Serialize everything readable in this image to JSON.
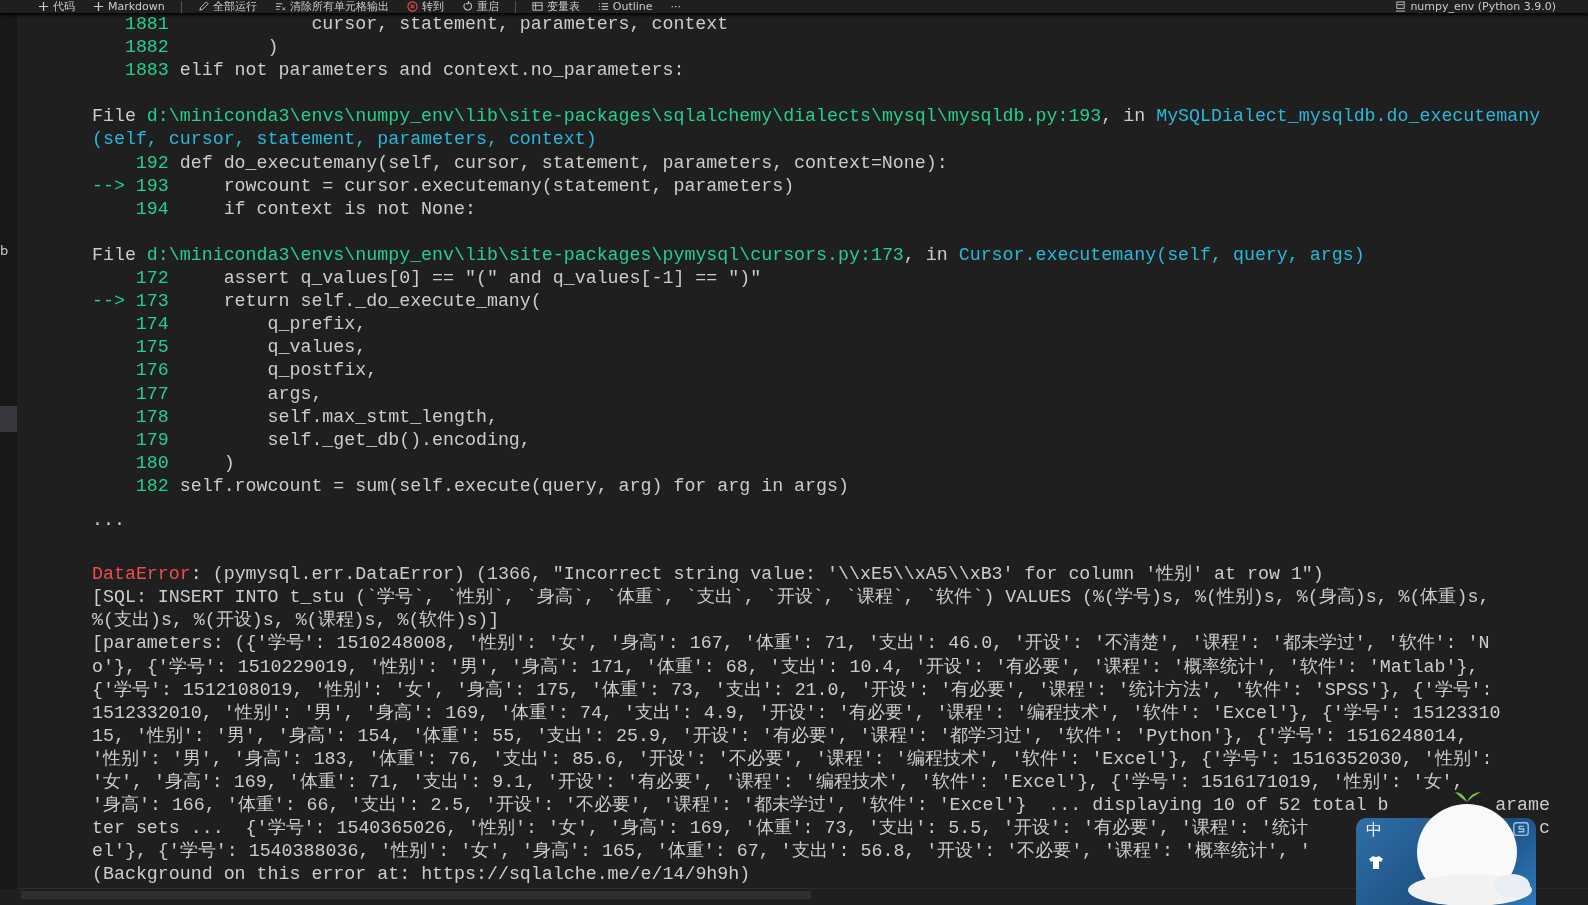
{
  "toolbar": {
    "items": [
      {
        "kind": "button",
        "label": "代码"
      },
      {
        "kind": "button",
        "label": "Markdown"
      },
      {
        "kind": "separator"
      },
      {
        "kind": "button",
        "label": "全部运行"
      },
      {
        "kind": "button",
        "label": "清除所有单元格输出"
      },
      {
        "kind": "button",
        "label": "转到"
      },
      {
        "kind": "button",
        "label": "重启"
      },
      {
        "kind": "separator"
      },
      {
        "kind": "button",
        "label": "变量表"
      },
      {
        "kind": "button",
        "label": "Outline"
      },
      {
        "kind": "more",
        "label": "···"
      }
    ],
    "kernel": "numpy_env (Python 3.9.0)"
  },
  "gutter": {
    "label": "b"
  },
  "output": {
    "frames": [
      {
        "lines": [
          {
            "lineno": "1881",
            "code": "            cursor, statement, parameters, context"
          },
          {
            "lineno": "1882",
            "code": "        )"
          },
          {
            "lineno": "1883",
            "code": "elif not parameters and context.no_parameters:"
          }
        ]
      },
      {
        "header": {
          "label": "File",
          "path": "d:\\miniconda3\\envs\\numpy_env\\lib\\site-packages\\sqlalchemy\\dialects\\mysql\\mysqldb.py:193",
          "sep": ", in",
          "function": [
            "MySQLDialect_mysqldb.do_executemany",
            "(self, cursor, statement, parameters, context)"
          ]
        },
        "lines": [
          {
            "lineno": "192",
            "code": "def do_executemany(self, cursor, statement, parameters, context=None):"
          },
          {
            "marker": "-->",
            "lineno": "193",
            "code": "    rowcount = cursor.executemany(statement, parameters)"
          },
          {
            "lineno": "194",
            "code": "    if context is not None:"
          }
        ]
      },
      {
        "header": {
          "label": "File",
          "path": "d:\\miniconda3\\envs\\numpy_env\\lib\\site-packages\\pymysql\\cursors.py:173",
          "sep": ", in",
          "function": [
            "Cursor.executemany(self, query, args)"
          ]
        },
        "lines": [
          {
            "lineno": "172",
            "code": "    assert q_values[0] == \"(\" and q_values[-1] == \")\""
          },
          {
            "marker": "-->",
            "lineno": "173",
            "code": "    return self._do_execute_many("
          },
          {
            "lineno": "174",
            "code": "        q_prefix,"
          },
          {
            "lineno": "175",
            "code": "        q_values,"
          },
          {
            "lineno": "176",
            "code": "        q_postfix,"
          },
          {
            "lineno": "177",
            "code": "        args,"
          },
          {
            "lineno": "178",
            "code": "        self.max_stmt_length,"
          },
          {
            "lineno": "179",
            "code": "        self._get_db().encoding,"
          },
          {
            "lineno": "180",
            "code": "    )"
          },
          {
            "lineno": "182",
            "code": "self.rowcount = sum(self.execute(query, arg) for arg in args)"
          }
        ]
      }
    ],
    "ellipsis": "...",
    "error": {
      "name": "DataError",
      "message": ": (pymysql.err.DataError) (1366, \"Incorrect string value: '\\\\xE5\\\\xA5\\\\xB3' for column '性别' at row 1\")",
      "lines": [
        {
          "text": "[SQL: INSERT INTO t_stu (`学号`, `性别`, `身高`, `体重`, `支出`, `开设`, `课程`, `软件`) VALUES (%(学号)s, %(性别)s, %(身高)s, %(体重)s,"
        },
        {
          "text": "%(支出)s, %(开设)s, %(课程)s, %(软件)s)]"
        },
        {
          "text": "[parameters: ({'学号': 1510248008, '性别': '女', '身高': 167, '体重': 71, '支出': 46.0, '开设': '不清楚', '课程': '都未学过', '软件': 'N"
        },
        {
          "text": "o'}, {'学号': 1510229019, '性别': '男', '身高': 171, '体重': 68, '支出': 10.4, '开设': '有必要', '课程': '概率统计', '软件': 'Matlab'},"
        },
        {
          "text": "{'学号': 1512108019, '性别': '女', '身高': 175, '体重': 73, '支出': 21.0, '开设': '有必要', '课程': '统计方法', '软件': 'SPSS'}, {'学号':"
        },
        {
          "text": "1512332010, '性别': '男', '身高': 169, '体重': 74, '支出': 4.9, '开设': '有必要', '课程': '编程技术', '软件': 'Excel'}, {'学号': 15123310"
        },
        {
          "text": "15, '性别': '男', '身高': 154, '体重': 55, '支出': 25.9, '开设': '有必要', '课程': '都学习过', '软件': 'Python'}, {'学号': 1516248014,"
        },
        {
          "text": "'性别': '男', '身高': 183, '体重': 76, '支出': 85.6, '开设': '不必要', '课程': '编程技术', '软件': 'Excel'}, {'学号': 1516352030, '性别':"
        },
        {
          "text": "'女', '身高': 169, '体重': 71, '支出': 9.1, '开设': '有必要', '课程': '编程技术', '软件': 'Excel'}, {'学号': 1516171019, '性别': '女',"
        },
        {
          "text": "'身高': 166, '体重': 66, '支出': 2.5, '开设': '不必要', '课程': '都未学过', '软件': 'Excel'}  ... displaying 10 of 52 total b",
          "tail": "arame"
        },
        {
          "text": "ter sets ...  {'学号': 1540365026, '性别': '女', '身高': 169, '体重': 73, '支出': 5.5, '开设': '有必要', '课程': '统计",
          "tail": "c"
        },
        {
          "text": "el'}, {'学号': 1540388036, '性别': '女', '身高': 165, '体重': 67, '支出': 56.8, '开设': '不必要', '课程': '概率统计', '"
        }
      ],
      "footer": {
        "prefix": "(Background on this error at: ",
        "link": "https://sqlalche.me/e/14/9h9h",
        "suffix": ")"
      }
    }
  },
  "ime": {
    "mode": "中"
  }
}
